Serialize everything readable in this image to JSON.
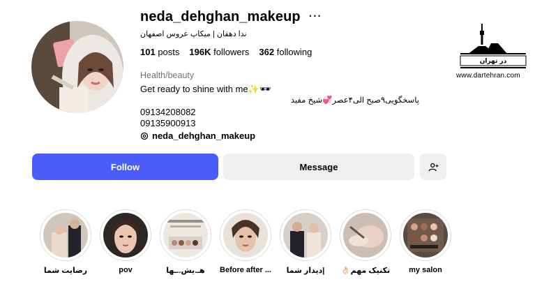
{
  "profile": {
    "username": "neda_dehghan_makeup",
    "more_label": "···",
    "fullname": "ندا دهقان | میکاپ عروس اصفهان",
    "stats": {
      "posts_count": "101",
      "posts_label": "posts",
      "followers_count": "196K",
      "followers_label": "followers",
      "following_count": "362",
      "following_label": "following"
    },
    "category": "Health/beauty",
    "bio": [
      "Get ready to shine with me✨🕶",
      "پاسخگویی۹صبح الی۴عصر💞شیخ مفید",
      "09134208082",
      "09135900913"
    ],
    "threads_handle": "neda_dehghan_makeup"
  },
  "actions": {
    "follow_label": "Follow",
    "message_label": "Message"
  },
  "watermark": {
    "logo_text": "در تهران",
    "url": "www.dartehran.com"
  },
  "highlights": [
    {
      "label": "رضایت شما"
    },
    {
      "label": "pov"
    },
    {
      "label": "هـ.یش..ـها"
    },
    {
      "label": "Before after ..."
    },
    {
      "label": "|دیدار شما"
    },
    {
      "label": "تکنیک مهم👌🏻"
    },
    {
      "label": "my salon"
    }
  ],
  "colors": {
    "follow_button": "#4a5df9",
    "secondary_button": "#efefef",
    "muted_text": "#737373"
  }
}
